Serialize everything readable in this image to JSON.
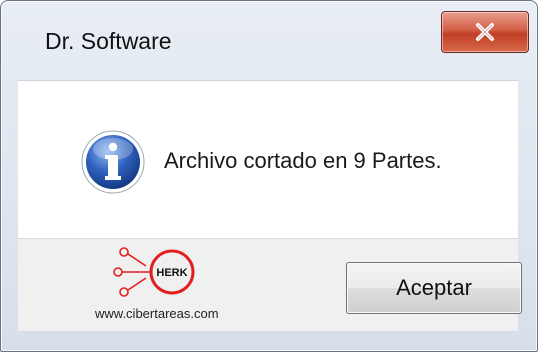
{
  "dialog": {
    "title": "Dr. Software",
    "message": "Archivo cortado en 9 Partes.",
    "ok_label": "Aceptar",
    "close_icon": "close-icon",
    "info_icon": "info-icon"
  },
  "watermark": {
    "logo_text": "HERK",
    "url": "www.cibertareas.com"
  },
  "colors": {
    "close_button": "#c84a30",
    "info_icon": "#2b5fb8",
    "logo_ring": "#e02020"
  }
}
